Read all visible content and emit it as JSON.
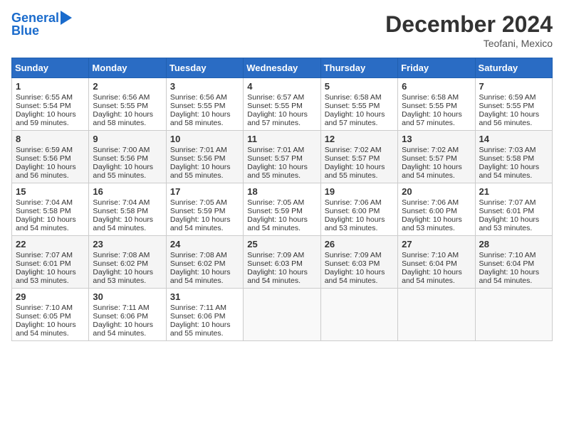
{
  "header": {
    "logo_line1": "General",
    "logo_line2": "Blue",
    "month_title": "December 2024",
    "location": "Teofani, Mexico"
  },
  "days_of_week": [
    "Sunday",
    "Monday",
    "Tuesday",
    "Wednesday",
    "Thursday",
    "Friday",
    "Saturday"
  ],
  "weeks": [
    [
      {
        "day": "1",
        "sunrise": "6:55 AM",
        "sunset": "5:54 PM",
        "daylight": "10 hours and 59 minutes."
      },
      {
        "day": "2",
        "sunrise": "6:56 AM",
        "sunset": "5:55 PM",
        "daylight": "10 hours and 58 minutes."
      },
      {
        "day": "3",
        "sunrise": "6:56 AM",
        "sunset": "5:55 PM",
        "daylight": "10 hours and 58 minutes."
      },
      {
        "day": "4",
        "sunrise": "6:57 AM",
        "sunset": "5:55 PM",
        "daylight": "10 hours and 57 minutes."
      },
      {
        "day": "5",
        "sunrise": "6:58 AM",
        "sunset": "5:55 PM",
        "daylight": "10 hours and 57 minutes."
      },
      {
        "day": "6",
        "sunrise": "6:58 AM",
        "sunset": "5:55 PM",
        "daylight": "10 hours and 57 minutes."
      },
      {
        "day": "7",
        "sunrise": "6:59 AM",
        "sunset": "5:55 PM",
        "daylight": "10 hours and 56 minutes."
      }
    ],
    [
      {
        "day": "8",
        "sunrise": "6:59 AM",
        "sunset": "5:56 PM",
        "daylight": "10 hours and 56 minutes."
      },
      {
        "day": "9",
        "sunrise": "7:00 AM",
        "sunset": "5:56 PM",
        "daylight": "10 hours and 55 minutes."
      },
      {
        "day": "10",
        "sunrise": "7:01 AM",
        "sunset": "5:56 PM",
        "daylight": "10 hours and 55 minutes."
      },
      {
        "day": "11",
        "sunrise": "7:01 AM",
        "sunset": "5:57 PM",
        "daylight": "10 hours and 55 minutes."
      },
      {
        "day": "12",
        "sunrise": "7:02 AM",
        "sunset": "5:57 PM",
        "daylight": "10 hours and 55 minutes."
      },
      {
        "day": "13",
        "sunrise": "7:02 AM",
        "sunset": "5:57 PM",
        "daylight": "10 hours and 54 minutes."
      },
      {
        "day": "14",
        "sunrise": "7:03 AM",
        "sunset": "5:58 PM",
        "daylight": "10 hours and 54 minutes."
      }
    ],
    [
      {
        "day": "15",
        "sunrise": "7:04 AM",
        "sunset": "5:58 PM",
        "daylight": "10 hours and 54 minutes."
      },
      {
        "day": "16",
        "sunrise": "7:04 AM",
        "sunset": "5:58 PM",
        "daylight": "10 hours and 54 minutes."
      },
      {
        "day": "17",
        "sunrise": "7:05 AM",
        "sunset": "5:59 PM",
        "daylight": "10 hours and 54 minutes."
      },
      {
        "day": "18",
        "sunrise": "7:05 AM",
        "sunset": "5:59 PM",
        "daylight": "10 hours and 54 minutes."
      },
      {
        "day": "19",
        "sunrise": "7:06 AM",
        "sunset": "6:00 PM",
        "daylight": "10 hours and 53 minutes."
      },
      {
        "day": "20",
        "sunrise": "7:06 AM",
        "sunset": "6:00 PM",
        "daylight": "10 hours and 53 minutes."
      },
      {
        "day": "21",
        "sunrise": "7:07 AM",
        "sunset": "6:01 PM",
        "daylight": "10 hours and 53 minutes."
      }
    ],
    [
      {
        "day": "22",
        "sunrise": "7:07 AM",
        "sunset": "6:01 PM",
        "daylight": "10 hours and 53 minutes."
      },
      {
        "day": "23",
        "sunrise": "7:08 AM",
        "sunset": "6:02 PM",
        "daylight": "10 hours and 53 minutes."
      },
      {
        "day": "24",
        "sunrise": "7:08 AM",
        "sunset": "6:02 PM",
        "daylight": "10 hours and 54 minutes."
      },
      {
        "day": "25",
        "sunrise": "7:09 AM",
        "sunset": "6:03 PM",
        "daylight": "10 hours and 54 minutes."
      },
      {
        "day": "26",
        "sunrise": "7:09 AM",
        "sunset": "6:03 PM",
        "daylight": "10 hours and 54 minutes."
      },
      {
        "day": "27",
        "sunrise": "7:10 AM",
        "sunset": "6:04 PM",
        "daylight": "10 hours and 54 minutes."
      },
      {
        "day": "28",
        "sunrise": "7:10 AM",
        "sunset": "6:04 PM",
        "daylight": "10 hours and 54 minutes."
      }
    ],
    [
      {
        "day": "29",
        "sunrise": "7:10 AM",
        "sunset": "6:05 PM",
        "daylight": "10 hours and 54 minutes."
      },
      {
        "day": "30",
        "sunrise": "7:11 AM",
        "sunset": "6:06 PM",
        "daylight": "10 hours and 54 minutes."
      },
      {
        "day": "31",
        "sunrise": "7:11 AM",
        "sunset": "6:06 PM",
        "daylight": "10 hours and 55 minutes."
      },
      null,
      null,
      null,
      null
    ]
  ]
}
